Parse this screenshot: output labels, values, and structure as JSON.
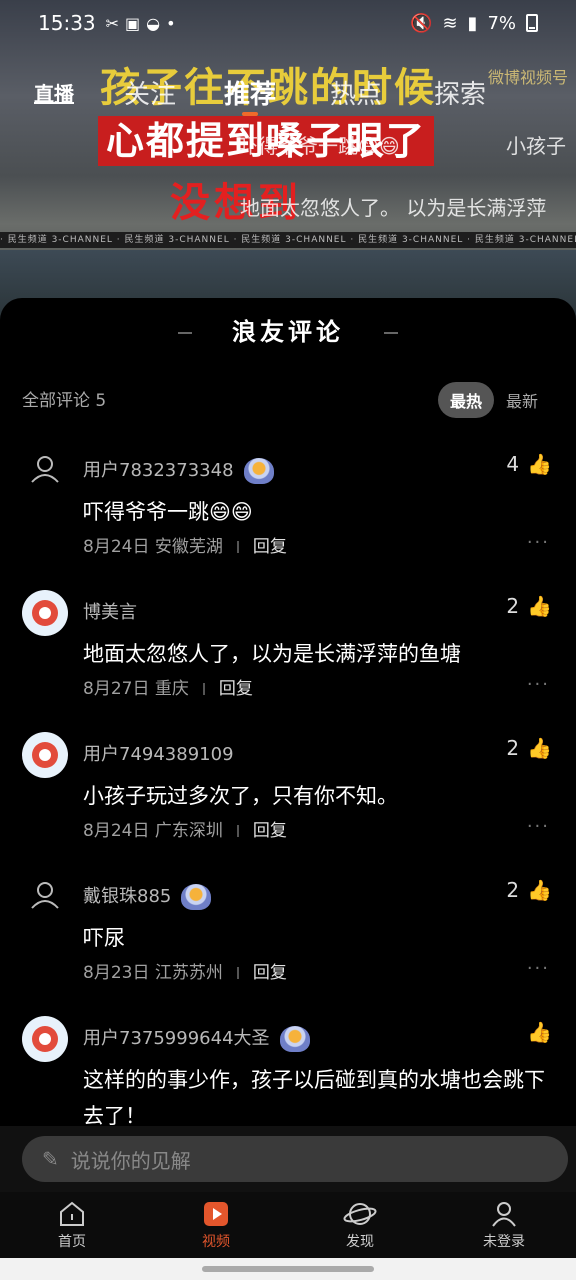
{
  "status": {
    "time": "15:33",
    "battery": "7%"
  },
  "video": {
    "caption1": "孩子往不跳的时候",
    "caption2": "心都提到嗓子眼了",
    "caption3": "没想到",
    "watermark": "微博视频号",
    "stripe": "· 民生频道 3-CHANNEL · 民生频道 3-CHANNEL · 民生频道 3-CHANNEL · 民生频道 3-CHANNEL · 民生频道 3-CHANNEL · 民生频道 3-CHANNEL",
    "danmu1": "吓得爷爷一跳😄😄",
    "danmu2": "小孩子",
    "danmu3": "地面太忽悠人了。 以为是长满浮萍"
  },
  "topnav": {
    "live": "直播",
    "tabs": [
      {
        "label": "关注"
      },
      {
        "label": "推荐"
      },
      {
        "label": "热点"
      },
      {
        "label": "探索"
      }
    ]
  },
  "sheet": {
    "title": "浪友评论",
    "filter": "全部评论 5",
    "sort_hot": "最热",
    "sort_new": "最新"
  },
  "comments": [
    {
      "user": "用户7832373348",
      "likes": "4",
      "text": "吓得爷爷一跳😄😄",
      "date": "8月24日",
      "location": "安徽芜湖",
      "reply": "回复"
    },
    {
      "user": "博美言",
      "likes": "2",
      "text": "地面太忽悠人了，以为是长满浮萍的鱼塘",
      "date": "8月27日",
      "location": "重庆",
      "reply": "回复"
    },
    {
      "user": "用户7494389109",
      "likes": "2",
      "text": "小孩子玩过多次了，只有你不知。",
      "date": "8月24日",
      "location": "广东深圳",
      "reply": "回复"
    },
    {
      "user": "戴银珠885",
      "likes": "2",
      "text": "吓尿",
      "date": "8月23日",
      "location": "江苏苏州",
      "reply": "回复"
    },
    {
      "user": "用户7375999644大圣",
      "likes": "",
      "text": "这样的的事少作，孩子以后碰到真的水塘也会跳下去了！",
      "date": "",
      "location": "",
      "reply": ""
    }
  ],
  "input": {
    "placeholder": "说说你的见解"
  },
  "bottomnav": [
    {
      "label": "首页"
    },
    {
      "label": "视频"
    },
    {
      "label": "发现"
    },
    {
      "label": "未登录"
    }
  ],
  "colors": {
    "accent": "#e3562c",
    "badge_bg": "#555555"
  }
}
